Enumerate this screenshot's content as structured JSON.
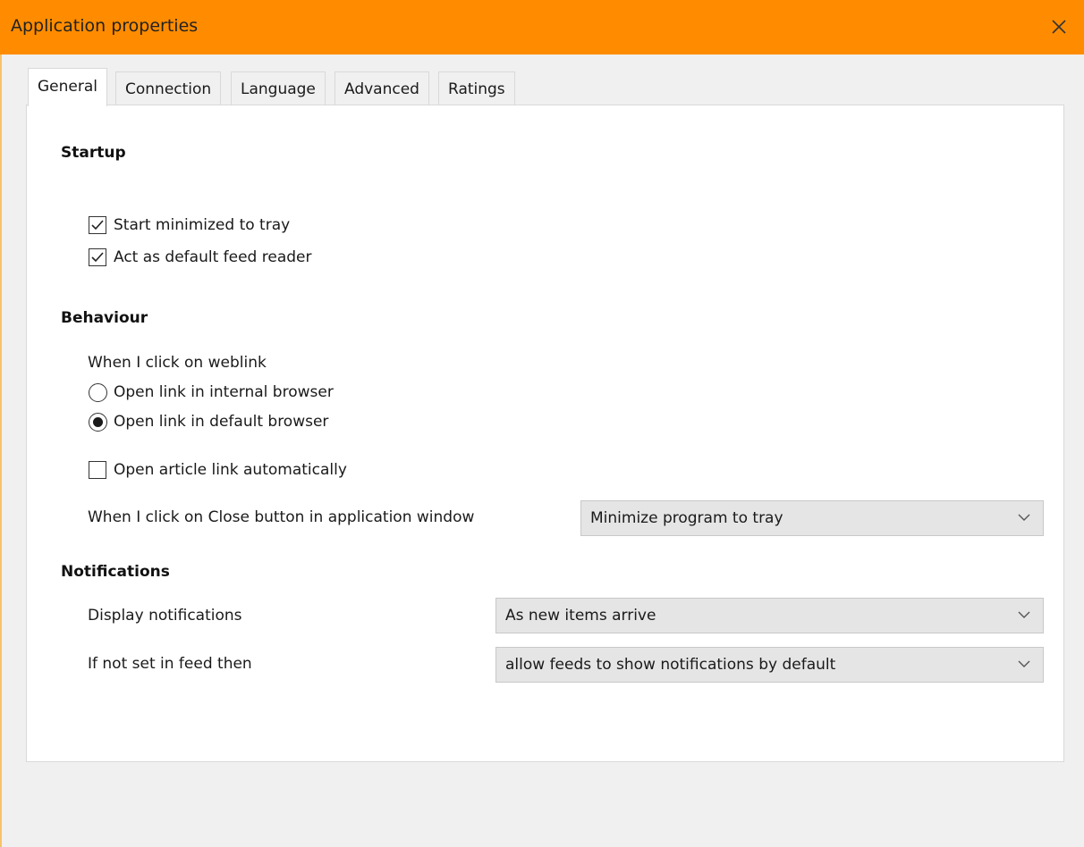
{
  "window": {
    "title": "Application properties",
    "close_icon": "close-icon",
    "accent_color": "#ff8c00"
  },
  "tabs": [
    {
      "label": "General",
      "active": true
    },
    {
      "label": "Connection",
      "active": false
    },
    {
      "label": "Language",
      "active": false
    },
    {
      "label": "Advanced",
      "active": false
    },
    {
      "label": "Ratings",
      "active": false
    }
  ],
  "startup": {
    "heading": "Startup",
    "start_minimized": {
      "label": "Start minimized to tray",
      "checked": true
    },
    "default_reader": {
      "label": "Act as default feed reader",
      "checked": true
    }
  },
  "behaviour": {
    "heading": "Behaviour",
    "weblink_prompt": "When I click on weblink",
    "radio_internal": {
      "label": "Open link in internal browser",
      "selected": false
    },
    "radio_default": {
      "label": "Open link in default browser",
      "selected": true
    },
    "auto_open": {
      "label": "Open article link automatically",
      "checked": false
    },
    "close_prompt": "When I click on Close button in application window",
    "close_action": "Minimize program to tray"
  },
  "notifications": {
    "heading": "Notifications",
    "display_label": "Display notifications",
    "display_value": "As new items arrive",
    "default_label": "If not set in feed then",
    "default_value": "allow feeds to show notifications by default"
  }
}
